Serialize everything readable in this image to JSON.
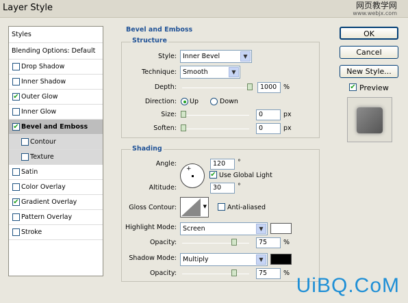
{
  "window": {
    "title": "Layer Style"
  },
  "watermark_top": {
    "line1": "网页教学网",
    "line2": "www.webjx.com"
  },
  "watermark_bottom": "UiBQ.CoM",
  "styles_panel": {
    "header": "Styles",
    "blending": "Blending Options: Default",
    "items": [
      {
        "label": "Drop Shadow",
        "checked": false
      },
      {
        "label": "Inner Shadow",
        "checked": false
      },
      {
        "label": "Outer Glow",
        "checked": true
      },
      {
        "label": "Inner Glow",
        "checked": false
      },
      {
        "label": "Bevel and Emboss",
        "checked": true,
        "selected": true
      },
      {
        "label": "Contour",
        "checked": false,
        "sub": true
      },
      {
        "label": "Texture",
        "checked": false,
        "sub": true
      },
      {
        "label": "Satin",
        "checked": false
      },
      {
        "label": "Color Overlay",
        "checked": false
      },
      {
        "label": "Gradient Overlay",
        "checked": true
      },
      {
        "label": "Pattern Overlay",
        "checked": false
      },
      {
        "label": "Stroke",
        "checked": false
      }
    ]
  },
  "bevel": {
    "section_title": "Bevel and Emboss",
    "structure": {
      "title": "Structure",
      "style_label": "Style:",
      "style_value": "Inner Bevel",
      "technique_label": "Technique:",
      "technique_value": "Smooth",
      "depth_label": "Depth:",
      "depth_value": "1000",
      "depth_unit": "%",
      "direction_label": "Direction:",
      "up_label": "Up",
      "down_label": "Down",
      "direction_value": "Up",
      "size_label": "Size:",
      "size_value": "0",
      "size_unit": "px",
      "soften_label": "Soften:",
      "soften_value": "0",
      "soften_unit": "px"
    },
    "shading": {
      "title": "Shading",
      "angle_label": "Angle:",
      "angle_value": "120",
      "angle_unit": "°",
      "global_light_label": "Use Global Light",
      "global_light": true,
      "altitude_label": "Altitude:",
      "altitude_value": "30",
      "altitude_unit": "°",
      "gloss_label": "Gloss Contour:",
      "antialiased_label": "Anti-aliased",
      "antialiased": false,
      "highlight_label": "Highlight Mode:",
      "highlight_value": "Screen",
      "highlight_color": "#ffffff",
      "hl_opacity_label": "Opacity:",
      "hl_opacity_value": "75",
      "hl_opacity_unit": "%",
      "shadow_label": "Shadow Mode:",
      "shadow_value": "Multiply",
      "shadow_color": "#000000",
      "sh_opacity_label": "Opacity:",
      "sh_opacity_value": "75",
      "sh_opacity_unit": "%"
    }
  },
  "buttons": {
    "ok": "OK",
    "cancel": "Cancel",
    "new_style": "New Style...",
    "preview_label": "Preview",
    "preview": true
  }
}
